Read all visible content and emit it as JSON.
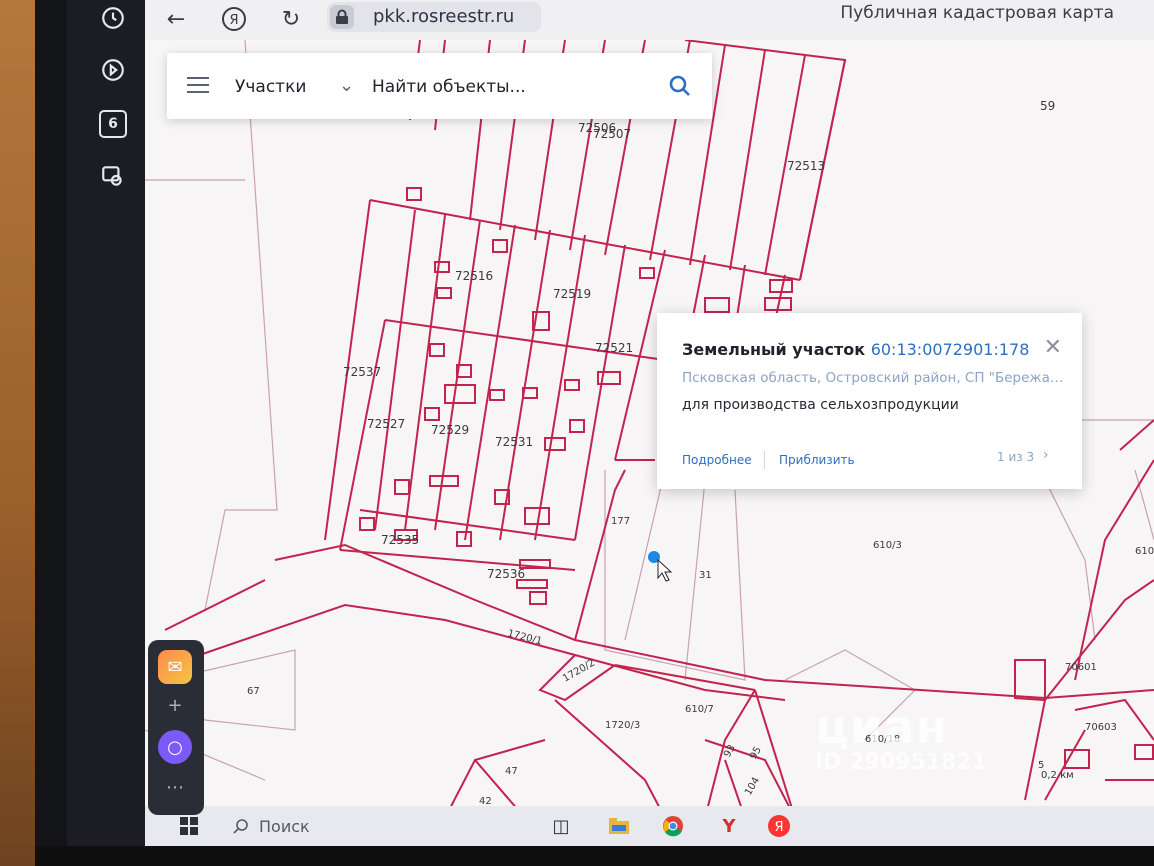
{
  "browser": {
    "url": "pkk.rosreestr.ru",
    "title": "Публичная кадастровая карта",
    "tab_count": "6"
  },
  "search": {
    "layer": "Участки",
    "placeholder": "Найти объекты..."
  },
  "card": {
    "type": "Земельный участок",
    "number": "60:13:0072901:178",
    "address": "Псковская область, Островский район, СП \"Бережан...",
    "usage": "для производства сельхозпродукции",
    "details_link": "Подробнее",
    "zoom_link": "Приблизить",
    "pagination": "1 из 3"
  },
  "map_labels": {
    "l59": "59",
    "l72506": "72506",
    "l72507": "72507",
    "l72513": "72513",
    "l72516": "72516",
    "l72519": "72519",
    "l72521": "72521",
    "l72537": "72537",
    "l72527": "72527",
    "l72529": "72529",
    "l72531": "72531",
    "l72535": "72535",
    "l72536": "72536",
    "l177": "177",
    "l31": "31",
    "l610_3": "610/3",
    "l610": "610",
    "l1720_1": "1720/1",
    "l1720_2": "1720/2",
    "l1720_3": "1720/3",
    "l610_7": "610/7",
    "l610_18": "610/18",
    "l67": "67",
    "l70601": "70601",
    "l70603": "70603",
    "l47": "47",
    "l42": "42",
    "l93": "93",
    "l95": "95",
    "l104": "104",
    "l5": "5"
  },
  "scale_label": "0,2 км",
  "watermark": {
    "logo": "циан",
    "id": "ID 290951821"
  },
  "taskbar": {
    "search_label": "Поиск"
  },
  "colors": {
    "parcel_line": "#c2234f",
    "link": "#2f6fc0",
    "address": "#8da4c4"
  }
}
